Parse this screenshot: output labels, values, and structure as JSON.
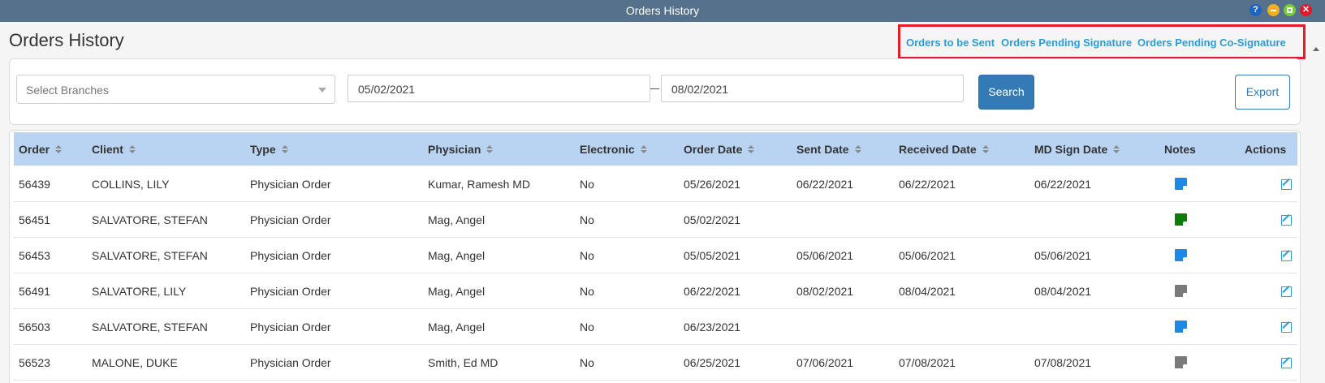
{
  "window": {
    "title": "Orders History"
  },
  "page": {
    "title": "Orders History"
  },
  "top_links": [
    {
      "label": "Orders to be Sent"
    },
    {
      "label": "Orders Pending Signature"
    },
    {
      "label": "Orders Pending Co-Signature"
    }
  ],
  "filters": {
    "branches_placeholder": "Select Branches",
    "date_from": "05/02/2021",
    "date_to": "08/02/2021",
    "search_label": "Search",
    "export_label": "Export"
  },
  "table": {
    "columns": [
      "Order",
      "Client",
      "Type",
      "Physician",
      "Electronic",
      "Order Date",
      "Sent Date",
      "Received Date",
      "MD Sign Date",
      "Notes",
      "Actions"
    ],
    "rows": [
      {
        "order": "56439",
        "client": "COLLINS, LILY",
        "type": "Physician Order",
        "physician": "Kumar, Ramesh MD",
        "electronic": "No",
        "order_date": "05/26/2021",
        "sent_date": "06/22/2021",
        "received_date": "06/22/2021",
        "md_sign_date": "06/22/2021",
        "note_color": "#1e88e5"
      },
      {
        "order": "56451",
        "client": "SALVATORE, STEFAN",
        "type": "Physician Order",
        "physician": "Mag, Angel",
        "electronic": "No",
        "order_date": "05/02/2021",
        "sent_date": "",
        "received_date": "",
        "md_sign_date": "",
        "note_color": "#0a7d0a"
      },
      {
        "order": "56453",
        "client": "SALVATORE, STEFAN",
        "type": "Physician Order",
        "physician": "Mag, Angel",
        "electronic": "No",
        "order_date": "05/05/2021",
        "sent_date": "05/06/2021",
        "received_date": "05/06/2021",
        "md_sign_date": "05/06/2021",
        "note_color": "#1e88e5"
      },
      {
        "order": "56491",
        "client": "SALVATORE, LILY",
        "type": "Physician Order",
        "physician": "Mag, Angel",
        "electronic": "No",
        "order_date": "06/22/2021",
        "sent_date": "08/02/2021",
        "received_date": "08/04/2021",
        "md_sign_date": "08/04/2021",
        "note_color": "#7a7a7a"
      },
      {
        "order": "56503",
        "client": "SALVATORE, STEFAN",
        "type": "Physician Order",
        "physician": "Mag, Angel",
        "electronic": "No",
        "order_date": "06/23/2021",
        "sent_date": "",
        "received_date": "",
        "md_sign_date": "",
        "note_color": "#1e88e5"
      },
      {
        "order": "56523",
        "client": "MALONE, DUKE",
        "type": "Physician Order",
        "physician": "Smith, Ed MD",
        "electronic": "No",
        "order_date": "06/25/2021",
        "sent_date": "07/06/2021",
        "received_date": "07/08/2021",
        "md_sign_date": "07/08/2021",
        "note_color": "#7a7a7a"
      }
    ]
  }
}
